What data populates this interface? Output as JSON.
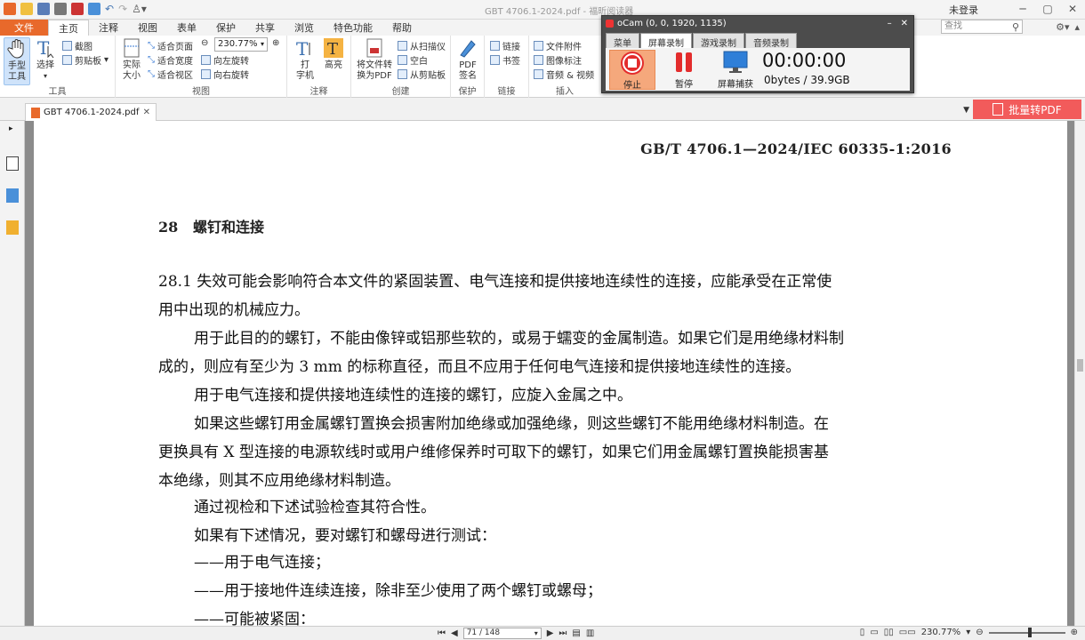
{
  "titlebar": {
    "document_title": "GBT 4706.1-2024.pdf - 福昕阅读器"
  },
  "menubar": {
    "tabs": [
      "文件",
      "主页",
      "注释",
      "视图",
      "表单",
      "保护",
      "共享",
      "浏览",
      "特色功能",
      "帮助"
    ],
    "active_tab": "主页",
    "login_label": "未登录",
    "search_placeholder": "查找"
  },
  "ribbon": {
    "tools": {
      "hand_label": "手型\n工具",
      "select_label": "选择",
      "screenshot_label": "截图",
      "clipboard_label": "剪贴板",
      "group_label": "工具"
    },
    "view": {
      "actual_size_label": "实际\n大小",
      "fit_page_label": "适合页面",
      "fit_width_label": "适合宽度",
      "fit_visible_label": "适合视区",
      "zoom_value": "230.77%",
      "rotate_left_label": "向左旋转",
      "rotate_right_label": "向右旋转",
      "group_label": "视图"
    },
    "comment": {
      "typewriter_label": "打\n字机",
      "highlight_label": "高亮",
      "group_label": "注释"
    },
    "create": {
      "convert_label": "将文件转\n换为PDF",
      "from_scanner_label": "从扫描仪",
      "blank_label": "空白",
      "from_clipboard_label": "从剪贴板",
      "group_label": "创建"
    },
    "protect": {
      "sign_label": "PDF\n签名",
      "group_label": "保护"
    },
    "links": {
      "link_label": "链接",
      "bookmark_label": "书签",
      "group_label": "链接"
    },
    "insert": {
      "attachment_label": "文件附件",
      "image_label": "图像标注",
      "audio_video_label": "音频 & 视频",
      "group_label": "插入"
    }
  },
  "tabstrip": {
    "doc_tab_label": "GBT 4706.1-2024.pdf",
    "batch_button_label": "批量转PDF"
  },
  "page": {
    "header": "GB/T 4706.1—2024/IEC 60335-1:2016",
    "section_title": "28   螺钉和连接",
    "lines": [
      "28.1   失效可能会影响符合本文件的紧固装置、电气连接和提供接地连续性的连接，应能承受在正常使",
      "用中出现的机械应力。",
      "用于此目的的螺钉，不能由像锌或铝那些软的，或易于蠕变的金属制造。如果它们是用绝缘材料制",
      "成的，则应有至少为 3 mm 的标称直径，而且不应用于任何电气连接和提供接地连续性的连接。",
      "用于电气连接和提供接地连续性的连接的螺钉，应旋入金属之中。",
      "如果这些螺钉用金属螺钉置换会损害附加绝缘或加强绝缘，则这些螺钉不能用绝缘材料制造。在",
      "更换具有 X 型连接的电源软线时或用户维修保养时可取下的螺钉，如果它们用金属螺钉置换能损害基",
      "本绝缘，则其不应用绝缘材料制造。",
      "通过视检和下述试验检查其符合性。",
      "如果有下述情况，要对螺钉和螺母进行测试：",
      "——用于电气连接；",
      "——用于接地件连续连接，除非至少使用了两个螺钉或螺母；",
      "——可能被紧固："
    ]
  },
  "statusbar": {
    "page_indicator": "71 / 148",
    "zoom_value": "230.77%"
  },
  "ocam": {
    "title": "oCam (0, 0, 1920, 1135)",
    "tabs": [
      "菜单",
      "屏幕录制",
      "游戏录制",
      "音频录制"
    ],
    "active_tab": "屏幕录制",
    "stop_label": "停止",
    "pause_label": "暂停",
    "capture_label": "屏幕捕获",
    "timer": "00:00:00",
    "size": "0bytes / 39.9GB"
  },
  "colors": {
    "file_tab": "#e8692b",
    "batch_button": "#f25b5b",
    "ocam_frame": "#4c4c4c",
    "ocam_stop_bg": "#f5a87c",
    "record_red": "#e32c2c"
  }
}
